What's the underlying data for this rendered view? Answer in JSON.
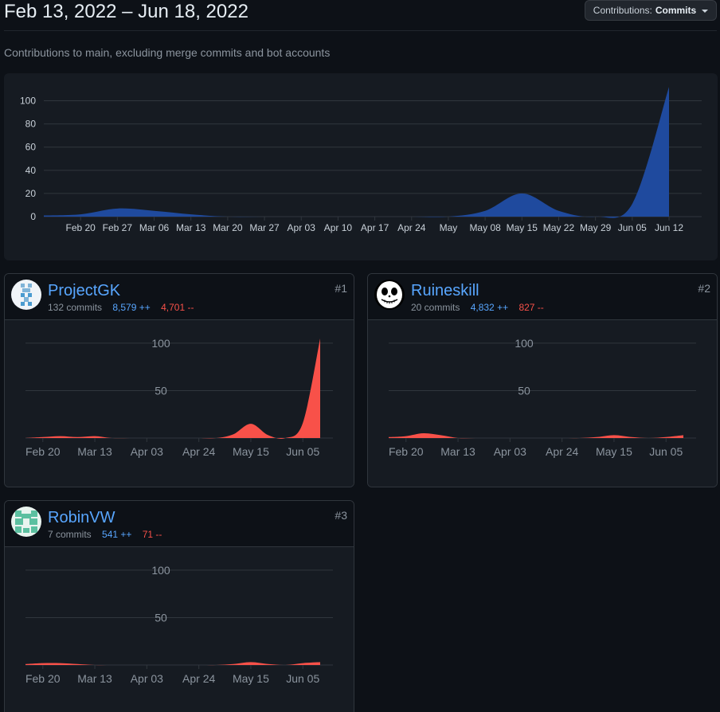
{
  "header": {
    "date_range": "Feb 13, 2022 – Jun 18, 2022",
    "contrib_select_prefix": "Contributions:",
    "contrib_select_value": "Commits",
    "subtitle": "Contributions to main, excluding merge commits and bot accounts"
  },
  "colors": {
    "main_area": "#1f4a9e",
    "user_area": "#f85149",
    "link": "#58a6ff",
    "deletions": "#f85149"
  },
  "chart_data": [
    {
      "type": "area",
      "title": "",
      "ylim": [
        0,
        110
      ],
      "y_ticks": [
        "0",
        "20",
        "40",
        "60",
        "80",
        "100"
      ],
      "x_ticks": [
        "Feb 20",
        "Feb 27",
        "Mar 06",
        "Mar 13",
        "Mar 20",
        "Mar 27",
        "Apr 03",
        "Apr 10",
        "Apr 17",
        "Apr 24",
        "May",
        "May 08",
        "May 15",
        "May 22",
        "May 29",
        "Jun 05",
        "Jun 12"
      ],
      "x": [
        "Feb 13",
        "Feb 20",
        "Feb 27",
        "Mar 06",
        "Mar 13",
        "Mar 20",
        "Mar 27",
        "Apr 03",
        "Apr 10",
        "Apr 17",
        "Apr 24",
        "May 01",
        "May 08",
        "May 15",
        "May 22",
        "May 29",
        "Jun 05",
        "Jun 12"
      ],
      "values": [
        1,
        2,
        7,
        5,
        2,
        0,
        0,
        0,
        0,
        0,
        0,
        0,
        5,
        20,
        5,
        0,
        11,
        112
      ]
    }
  ],
  "contributors": [
    {
      "name": "ProjectGK",
      "commits": "132 commits",
      "additions": "8,579 ++",
      "deletions": "4,701 --",
      "rank": "#1",
      "avatar": "blue-identicon",
      "chart_data": {
        "type": "area",
        "ylim": [
          0,
          110
        ],
        "y_ticks": [
          "50",
          "100"
        ],
        "x_ticks": [
          "Feb 20",
          "Mar 13",
          "Apr 03",
          "Apr 24",
          "May 15",
          "Jun 05"
        ],
        "x": [
          "Feb 13",
          "Feb 20",
          "Feb 27",
          "Mar 06",
          "Mar 13",
          "Mar 20",
          "Mar 27",
          "Apr 03",
          "Apr 10",
          "Apr 17",
          "Apr 24",
          "May 01",
          "May 08",
          "May 15",
          "May 22",
          "May 29",
          "Jun 05",
          "Jun 12"
        ],
        "values": [
          0,
          1,
          2,
          1,
          2,
          0,
          0,
          0,
          0,
          0,
          0,
          0,
          4,
          15,
          3,
          0,
          16,
          105
        ]
      }
    },
    {
      "name": "Ruineskill",
      "commits": "20 commits",
      "additions": "4,832 ++",
      "deletions": "827 --",
      "rank": "#2",
      "avatar": "skull-face",
      "chart_data": {
        "type": "area",
        "ylim": [
          0,
          110
        ],
        "y_ticks": [
          "50",
          "100"
        ],
        "x_ticks": [
          "Feb 20",
          "Mar 13",
          "Apr 03",
          "Apr 24",
          "May 15",
          "Jun 05"
        ],
        "x": [
          "Feb 13",
          "Feb 20",
          "Feb 27",
          "Mar 06",
          "Mar 13",
          "Mar 20",
          "Mar 27",
          "Apr 03",
          "Apr 10",
          "Apr 17",
          "Apr 24",
          "May 01",
          "May 08",
          "May 15",
          "May 22",
          "May 29",
          "Jun 05",
          "Jun 12"
        ],
        "values": [
          1,
          2,
          5,
          3,
          0,
          0,
          0,
          0,
          0,
          0,
          0,
          0,
          1,
          3,
          1,
          0,
          1,
          3
        ]
      }
    },
    {
      "name": "RobinVW",
      "commits": "7 commits",
      "additions": "541 ++",
      "deletions": "71 --",
      "rank": "#3",
      "avatar": "green-identicon",
      "chart_data": {
        "type": "area",
        "ylim": [
          0,
          110
        ],
        "y_ticks": [
          "50",
          "100"
        ],
        "x_ticks": [
          "Feb 20",
          "Mar 13",
          "Apr 03",
          "Apr 24",
          "May 15",
          "Jun 05"
        ],
        "x": [
          "Feb 13",
          "Feb 20",
          "Feb 27",
          "Mar 06",
          "Mar 13",
          "Mar 20",
          "Mar 27",
          "Apr 03",
          "Apr 10",
          "Apr 17",
          "Apr 24",
          "May 01",
          "May 08",
          "May 15",
          "May 22",
          "May 29",
          "Jun 05",
          "Jun 12"
        ],
        "values": [
          1,
          2,
          2,
          1,
          0,
          0,
          0,
          0,
          0,
          0,
          0,
          0,
          1,
          3,
          1,
          0,
          2,
          3
        ]
      }
    }
  ]
}
